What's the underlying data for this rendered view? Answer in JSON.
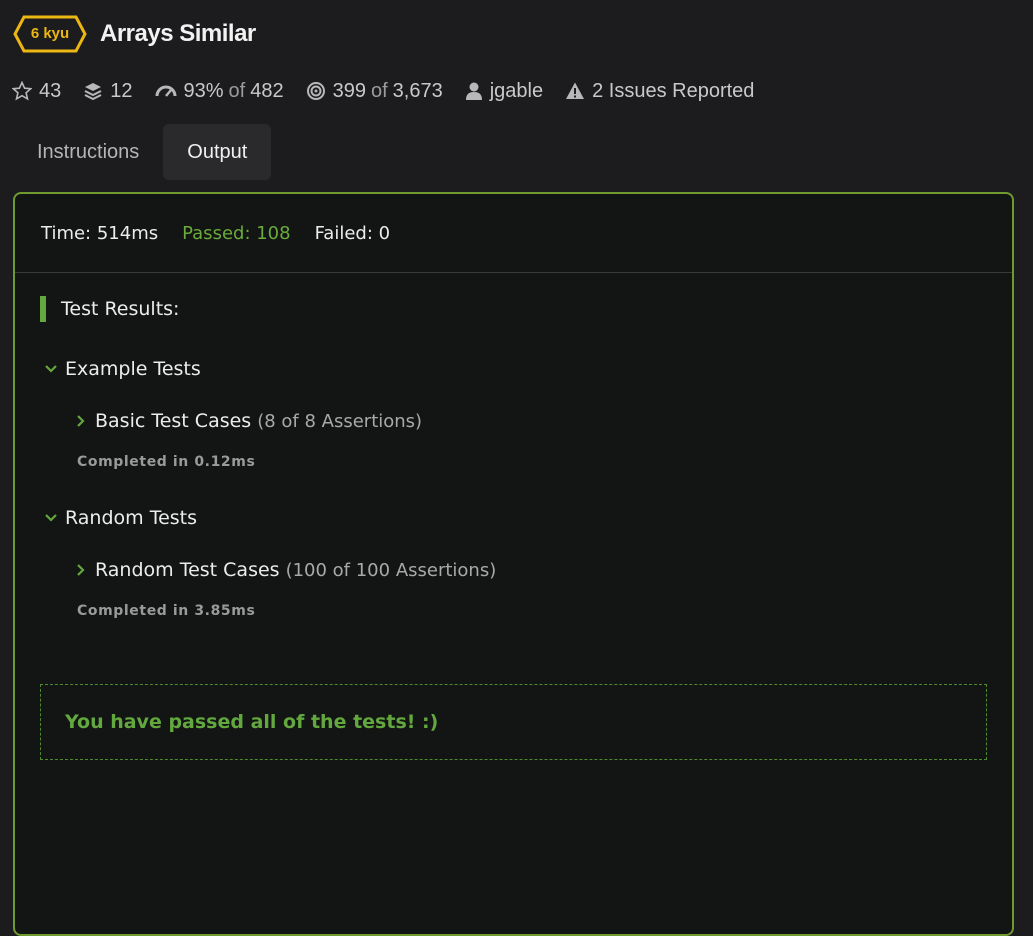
{
  "kata": {
    "rank": "6 kyu",
    "title": "Arrays Similar",
    "rank_color": "#ecb613"
  },
  "stats": {
    "stars": "43",
    "collections": "12",
    "satisfaction": "93%",
    "satisfaction_of": "of",
    "satisfaction_total": "482",
    "completed": "399",
    "completed_of": "of",
    "completed_total": "3,673",
    "author": "jgable",
    "issues": "2 Issues Reported"
  },
  "tabs": [
    {
      "label": "Instructions",
      "active": false
    },
    {
      "label": "Output",
      "active": true
    }
  ],
  "summary": {
    "time": "Time: 514ms",
    "passed": "Passed: 108",
    "failed": "Failed: 0"
  },
  "results": {
    "title": "Test Results:",
    "groups": [
      {
        "label": "Example Tests",
        "case_name": "Basic Test Cases",
        "assertions": "(8 of 8 Assertions)",
        "completed": "Completed in 0.12ms"
      },
      {
        "label": "Random Tests",
        "case_name": "Random Test Cases",
        "assertions": "(100 of 100 Assertions)",
        "completed": "Completed in 3.85ms"
      }
    ],
    "pass_message": "You have passed all of the tests! :)"
  },
  "colors": {
    "accent_green": "#62a83e",
    "panel_border": "#6e9a2f",
    "background": "#1c1c1e"
  }
}
